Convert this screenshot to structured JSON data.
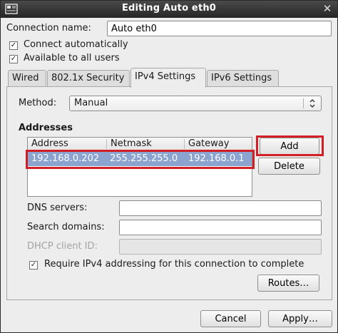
{
  "window": {
    "title": "Editing Auto eth0",
    "close_glyph": "✕"
  },
  "connection": {
    "name_label": "Connection name:",
    "name_value": "Auto eth0"
  },
  "options": {
    "connect_auto_label": "Connect automatically",
    "connect_auto_checked": true,
    "all_users_label": "Available to all users",
    "all_users_checked": true
  },
  "tabs": [
    {
      "label": "Wired",
      "active": false
    },
    {
      "label": "802.1x Security",
      "active": false
    },
    {
      "label": "IPv4 Settings",
      "active": true
    },
    {
      "label": "IPv6 Settings",
      "active": false
    }
  ],
  "ipv4": {
    "method_label": "Method:",
    "method_value": "Manual",
    "addresses_heading": "Addresses",
    "columns": [
      "Address",
      "Netmask",
      "Gateway"
    ],
    "rows": [
      {
        "address": "192.168.0.202",
        "netmask": "255.255.255.0",
        "gateway": "192.168.0.1",
        "selected": true
      }
    ],
    "add_label": "Add",
    "delete_label": "Delete",
    "dns_label": "DNS servers:",
    "dns_value": "",
    "search_label": "Search domains:",
    "search_value": "",
    "dhcp_label": "DHCP client ID:",
    "dhcp_value": "",
    "require_label": "Require IPv4 addressing for this connection to complete",
    "require_checked": true,
    "routes_label": "Routes…"
  },
  "footer": {
    "cancel_label": "Cancel",
    "apply_label": "Apply…"
  },
  "colors": {
    "selection": "#8aa4cf",
    "highlight": "#d21f26",
    "titlebar": "#2f2f2f"
  },
  "icons": {
    "window": "network-icon",
    "close": "close-icon",
    "dropdown": "updown-arrows-icon"
  }
}
